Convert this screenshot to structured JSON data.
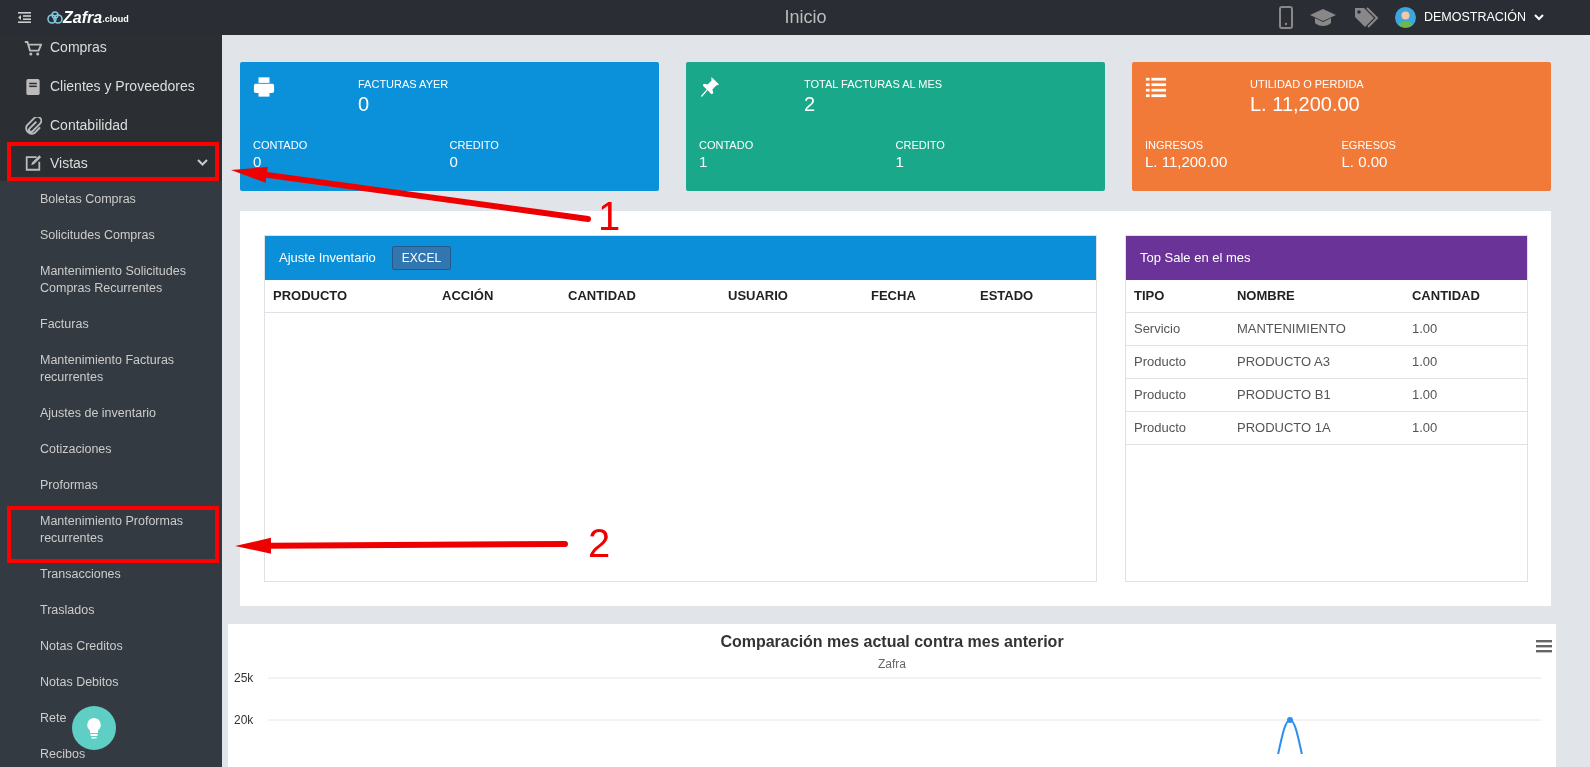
{
  "topbar": {
    "title": "Inicio",
    "user": "DEMOSTRACIÓN"
  },
  "logo": {
    "name": "Zafra",
    "suffix": ".cloud"
  },
  "sidebar": {
    "items": [
      {
        "label": "Compras"
      },
      {
        "label": "Clientes y Proveedores"
      },
      {
        "label": "Contabilidad"
      },
      {
        "label": "Vistas",
        "expanded": true,
        "children": [
          {
            "label": "Boletas Compras"
          },
          {
            "label": "Solicitudes Compras"
          },
          {
            "label": "Mantenimiento Solicitudes Compras Recurrentes"
          },
          {
            "label": "Facturas"
          },
          {
            "label": "Mantenimiento Facturas recurrentes"
          },
          {
            "label": "Ajustes de inventario"
          },
          {
            "label": "Cotizaciones"
          },
          {
            "label": "Proformas"
          },
          {
            "label": "Mantenimiento Proformas recurrentes"
          },
          {
            "label": "Transacciones"
          },
          {
            "label": "Traslados"
          },
          {
            "label": "Notas Creditos"
          },
          {
            "label": "Notas Debitos"
          },
          {
            "label": "Rete"
          },
          {
            "label": "Recibos"
          }
        ]
      }
    ]
  },
  "stats": [
    {
      "color": "#0b91d9",
      "title": "FACTURAS AYER",
      "value": "0",
      "left_label": "CONTADO",
      "left_value": "0",
      "right_label": "CREDITO",
      "right_value": "0"
    },
    {
      "color": "#1aa88a",
      "title": "TOTAL FACTURAS AL MES",
      "value": "2",
      "left_label": "CONTADO",
      "left_value": "1",
      "right_label": "CREDITO",
      "right_value": "1"
    },
    {
      "color": "#f27a38",
      "title": "UTILIDAD O PERDIDA",
      "value": "L. 11,200.00",
      "left_label": "INGRESOS",
      "left_value": "L. 11,200.00",
      "right_label": "EGRESOS",
      "right_value": "L. 0.00"
    }
  ],
  "inventory": {
    "title": "Ajuste Inventario",
    "button": "EXCEL",
    "columns": [
      "PRODUCTO",
      "ACCIÓN",
      "CANTIDAD",
      "USUARIO",
      "FECHA",
      "ESTADO"
    ]
  },
  "top_sale": {
    "title": "Top Sale en el mes",
    "columns": [
      "TIPO",
      "NOMBRE",
      "CANTIDAD"
    ],
    "rows": [
      [
        "Servicio",
        "MANTENIMIENTO",
        "1.00"
      ],
      [
        "Producto",
        "PRODUCTO A3",
        "1.00"
      ],
      [
        "Producto",
        "PRODUCTO B1",
        "1.00"
      ],
      [
        "Producto",
        "PRODUCTO 1A",
        "1.00"
      ]
    ]
  },
  "comparison": {
    "title": "Comparación mes actual contra mes anterior",
    "subtitle": "Zafra",
    "y_axis_labels": [
      "25k",
      "20k"
    ]
  },
  "annotations": [
    {
      "label": "1"
    },
    {
      "label": "2"
    }
  ]
}
